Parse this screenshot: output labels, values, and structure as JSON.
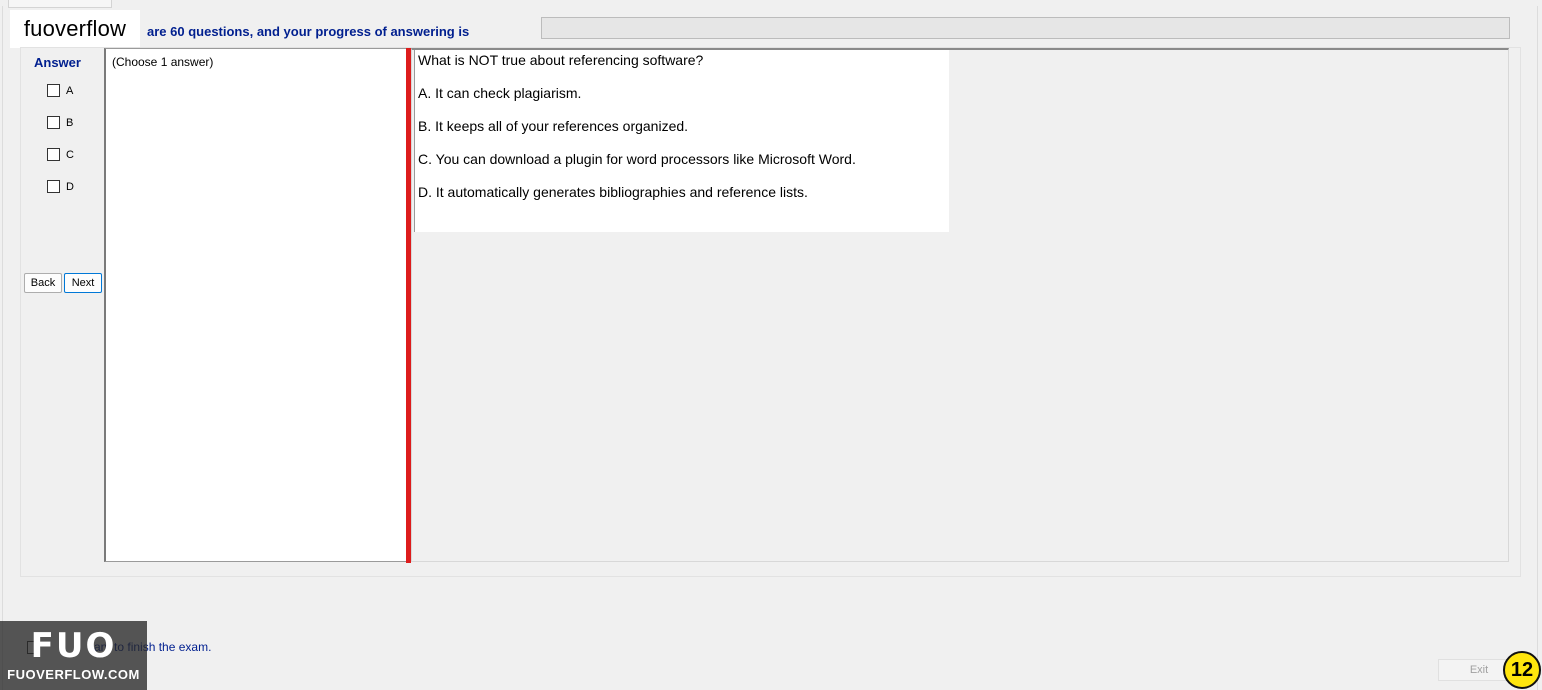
{
  "header": {
    "logo_text": "fuoverflow",
    "info_text": "are 60 questions, and your progress of answering is",
    "progress": 0
  },
  "sidebar": {
    "answer_title": "Answer",
    "options": [
      "A",
      "B",
      "C",
      "D"
    ],
    "back_label": "Back",
    "next_label": "Next"
  },
  "choose": {
    "instruction": "(Choose 1 answer)"
  },
  "question": {
    "text": "What is NOT true about referencing software?",
    "answers": [
      "A.  It can check plagiarism.",
      "B.  It keeps all of your references organized.",
      "C.  You can download a plugin for word processors like Microsoft Word.",
      "D.  It automatically generates bibliographies and reference lists."
    ]
  },
  "footer": {
    "finish_label": "ant to finish the exam.",
    "exit_label": "Exit",
    "page_badge": "12",
    "watermark_big": "FUO",
    "watermark_small": "FUOVERFLOW.COM"
  },
  "colors": {
    "accent_text": "#001f8f",
    "splitter": "#dd1c1c",
    "badge": "#ffe50d"
  }
}
